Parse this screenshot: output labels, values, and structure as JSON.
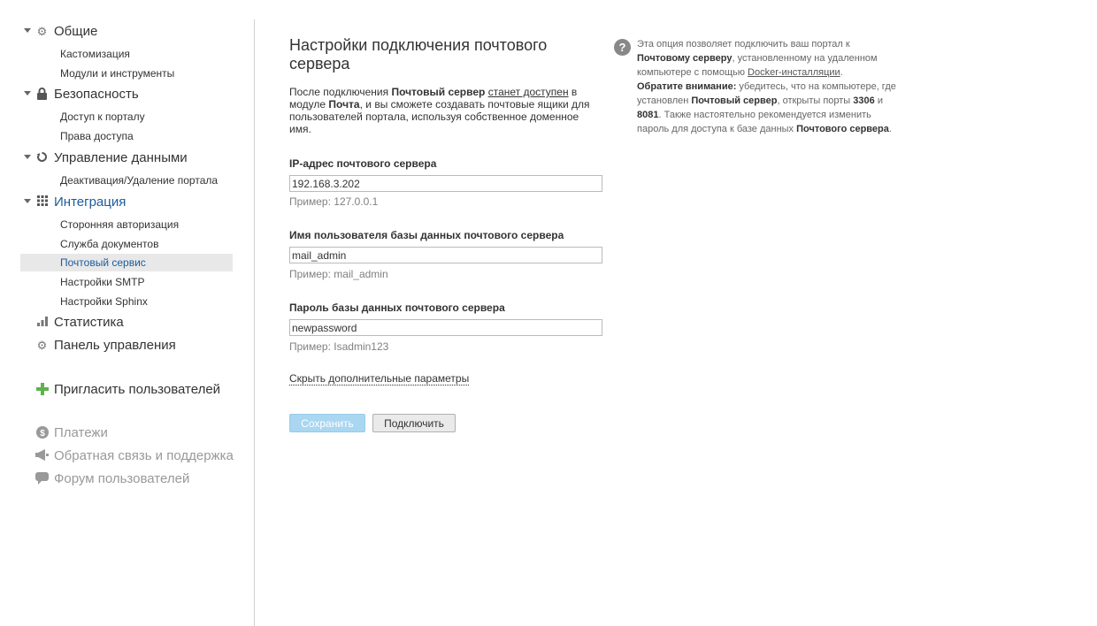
{
  "sidebar": {
    "groups": [
      {
        "label": "Общие",
        "icon": "gear-icon",
        "items": [
          "Кастомизация",
          "Модули и инструменты"
        ]
      },
      {
        "label": "Безопасность",
        "icon": "lock-icon",
        "items": [
          "Доступ к порталу",
          "Права доступа"
        ]
      },
      {
        "label": "Управление данными",
        "icon": "restore-icon",
        "items": [
          "Деактивация/Удаление портала"
        ]
      },
      {
        "label": "Интеграция",
        "icon": "grid-icon",
        "items": [
          "Сторонняя авторизация",
          "Служба документов",
          "Почтовый сервис",
          "Настройки SMTP",
          "Настройки Sphinx"
        ]
      }
    ],
    "statistics": "Статистика",
    "control_panel": "Панель управления",
    "invite": "Пригласить пользователей",
    "payments": "Платежи",
    "feedback": "Обратная связь и поддержка",
    "forum": "Форум пользователей"
  },
  "main": {
    "title": "Настройки подключения почтового сервера",
    "desc": {
      "p1": "После подключения ",
      "b1": "Почтовый сервер",
      "p2": " ",
      "link": "станет доступен",
      "p3": " в модуле ",
      "b2": "Почта",
      "p4": ", и вы сможете создавать почтовые ящики для пользователей портала, используя собственное доменное имя."
    },
    "fields": [
      {
        "label": "IP-адрес почтового сервера",
        "value": "192.168.3.202",
        "hint": "Пример: 127.0.0.1"
      },
      {
        "label": "Имя пользователя базы данных почтового сервера",
        "value": "mail_admin",
        "hint": "Пример: mail_admin"
      },
      {
        "label": "Пароль базы данных почтового сервера",
        "value": "newpassword",
        "hint": "Пример: Isadmin123"
      }
    ],
    "toggle": "Скрыть дополнительные параметры",
    "save": "Сохранить",
    "connect": "Подключить"
  },
  "help": {
    "t1": "Эта опция позволяет подключить ваш портал к ",
    "b1": "Почтовому серверу",
    "t2": ", установленному на удаленном компьютере с помощью ",
    "link": "Docker-инсталляции",
    "t3": ".",
    "b2": "Обратите внимание:",
    "t4": " убедитесь, что на компьютере, где установлен ",
    "b3": "Почтовый сервер",
    "t5": ", открыты порты ",
    "b4": "3306",
    "t6": " и ",
    "b5": "8081",
    "t7": ". Также настоятельно рекомендуется изменить пароль для доступа к базе данных ",
    "b6": "Почтового сервера",
    "t8": "."
  },
  "colors": {
    "accent": "#1a5c9c",
    "save_bg": "#a9d6f1",
    "invite_plus": "#5cb34a"
  }
}
